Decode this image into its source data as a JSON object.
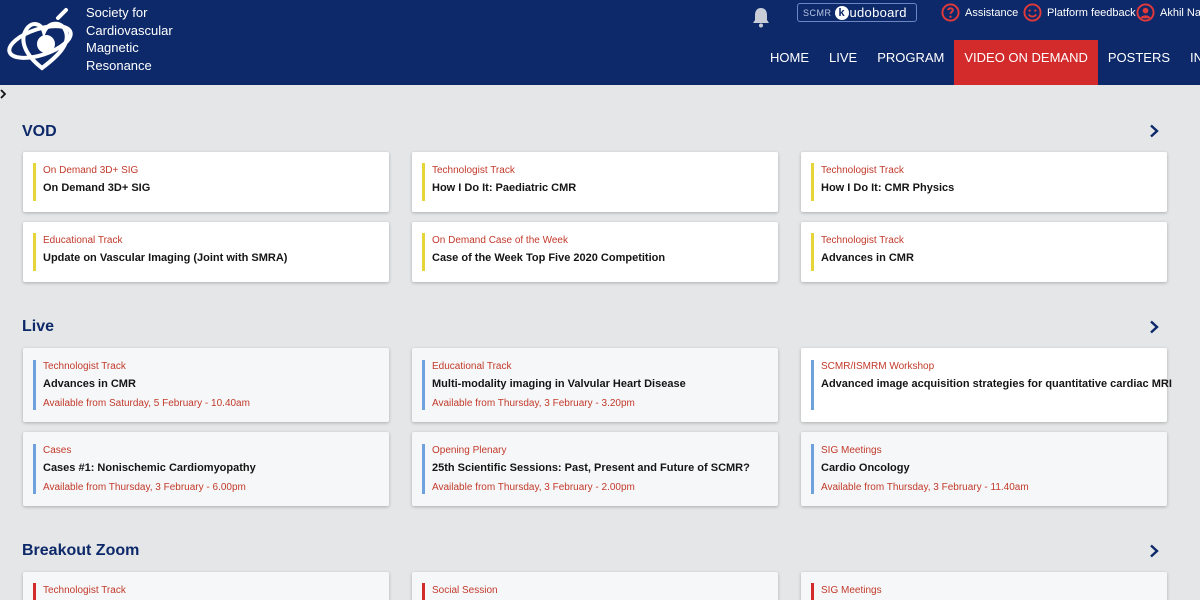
{
  "header": {
    "org_lines": [
      "Society for",
      "Cardiovascular",
      "Magnetic",
      "Resonance"
    ],
    "kudo_prefix": "SCMR",
    "kudo_k": "k",
    "kudo_name": "udoboard",
    "assistance": "Assistance",
    "feedback": "Platform feedback",
    "user": "Akhil Narai",
    "nav": [
      "HOME",
      "LIVE",
      "PROGRAM",
      "VIDEO ON DEMAND",
      "POSTERS",
      "INDUST"
    ]
  },
  "colors": {
    "header_bg": "#0d2969",
    "nav_active": "#d32b2b",
    "bar_yellow": "#e6d538",
    "bar_blue": "#6fa1dc",
    "bar_red": "#d32b2b"
  },
  "sections": [
    {
      "title": "VOD",
      "cards": [
        {
          "track": "On Demand 3D+ SIG",
          "title": "On Demand 3D+ SIG"
        },
        {
          "track": "Technologist Track",
          "title": "How I Do It: Paediatric CMR"
        },
        {
          "track": "Technologist Track",
          "title": "How I Do It: CMR Physics"
        },
        {
          "track": "Educational Track",
          "title": "Update on Vascular Imaging (Joint with SMRA)"
        },
        {
          "track": "On Demand Case of the Week",
          "title": "Case of the Week Top Five 2020 Competition"
        },
        {
          "track": "Technologist Track",
          "title": "Advances in CMR"
        }
      ]
    },
    {
      "title": "Live",
      "cards": [
        {
          "track": "Technologist Track",
          "title": "Advances in CMR",
          "avail": "Available from Saturday, 5 February - 10.40am"
        },
        {
          "track": "Educational Track",
          "title": "Multi-modality imaging in Valvular Heart Disease",
          "avail": "Available from Thursday, 3 February - 3.20pm"
        },
        {
          "track": "SCMR/ISMRM Workshop",
          "title": "Advanced image acquisition strategies for quantitative cardiac MRI",
          "avail": ""
        },
        {
          "track": "Cases",
          "title": "Cases #1: Nonischemic Cardiomyopathy",
          "avail": "Available from Thursday, 3 February - 6.00pm"
        },
        {
          "track": "Opening Plenary",
          "title": "25th Scientific Sessions: Past, Present and Future of SCMR?",
          "avail": "Available from Thursday, 3 February - 2.00pm"
        },
        {
          "track": "SIG Meetings",
          "title": "Cardio Oncology",
          "avail": "Available from Thursday, 3 February - 11.40am"
        }
      ]
    },
    {
      "title": "Breakout Zoom",
      "cards": [
        {
          "track": "Technologist Track"
        },
        {
          "track": "Social Session"
        },
        {
          "track": "SIG Meetings"
        }
      ]
    }
  ]
}
